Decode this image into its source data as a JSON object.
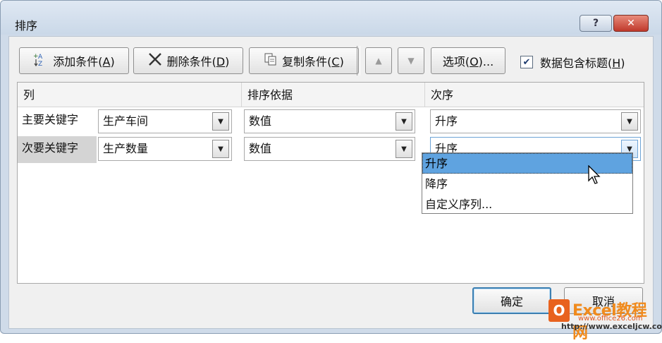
{
  "dialog": {
    "title": "排序",
    "help_label": "?",
    "close_label": "✕"
  },
  "toolbar": {
    "add_label": "添加条件(",
    "add_key": "A",
    "add_suffix": ")",
    "delete_label": "删除条件(",
    "delete_key": "D",
    "delete_suffix": ")",
    "copy_label": "复制条件(",
    "copy_key": "C",
    "copy_suffix": ")",
    "move_up_icon": "▲",
    "move_down_icon": "▼",
    "options_label": "选项(",
    "options_key": "O",
    "options_suffix": ")...",
    "header_checkbox_label": "数据包含标题(",
    "header_checkbox_key": "H",
    "header_checkbox_suffix": ")",
    "header_checkbox_checked": true
  },
  "grid": {
    "columns": [
      "列",
      "排序依据",
      "次序"
    ],
    "rows": [
      {
        "label": "主要关键字",
        "column": "生产车间",
        "sort_on": "数值",
        "order": "升序"
      },
      {
        "label": "次要关键字",
        "column": "生产数量",
        "sort_on": "数值",
        "order": "升序"
      }
    ]
  },
  "order_dropdown": {
    "options": [
      "升序",
      "降序",
      "自定义序列..."
    ],
    "highlighted": "升序"
  },
  "footer": {
    "ok_label": "确定",
    "cancel_label": "取消"
  },
  "watermark": {
    "logo_letter": "O",
    "title": "Excel教程网",
    "url_top": "www.office26.com",
    "url_bottom": "http://www.exceljcw.com"
  },
  "colors": {
    "accent": "#5fa3e0",
    "close_button": "#c0392b",
    "frame": "#cfdbe9"
  }
}
